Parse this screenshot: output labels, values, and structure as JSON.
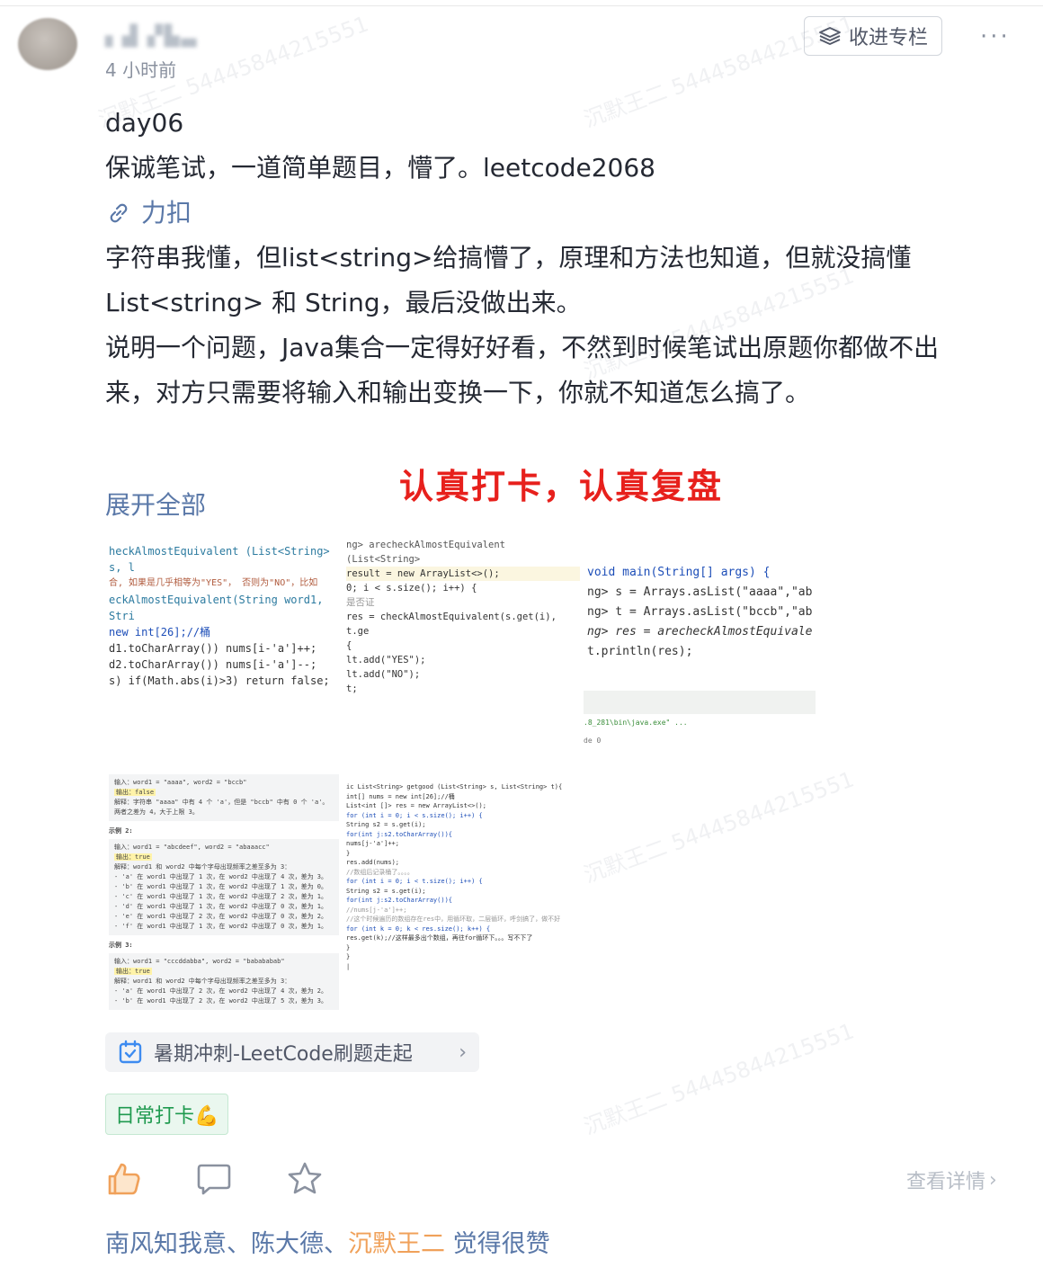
{
  "post": {
    "time": "4 小时前",
    "follow_label": "收进专栏",
    "more_label": "···",
    "lines": [
      "day06",
      "保诚笔试，一道简单题目，懵了。leetcode2068"
    ],
    "link_label": "力扣",
    "body": [
      "字符串我懂，但list<string>给搞懵了，原理和方法也知道，但就没搞懂",
      "List<string> 和 String，最后没做出来。",
      "说明一个问题，Java集合一定得好好看，不然到时候笔试出原题你都做不出",
      "来，对方只需要将输入和输出变换一下，你就不知道怎么搞了。"
    ],
    "red_banner": "认真打卡，认真复盘",
    "expand_label": "展开全部"
  },
  "screenshot": {
    "left_code": [
      "heckAlmostEquivalent (List<String> s, l",
      "合, 如果是几乎相等为\"YES\"， 否则为\"NO\"，比如",
      "",
      "",
      "eckAlmostEquivalent(String word1, Stri",
      "new int[26];//桶",
      "",
      "d1.toCharArray())  nums[i-'a']++;",
      "d2.toCharArray())  nums[i-'a']--;",
      "s) if(Math.abs(i)>3)  return false;"
    ],
    "mid_code": [
      "ng> arecheckAlmostEquivalent (List<String>",
      "",
      " result = new ArrayList<>();",
      "",
      "0; i < s.size(); i++) {",
      "是否证",
      "res = checkAlmostEquivalent(s.get(i), t.ge",
      "{",
      "lt.add(\"YES\");",
      "",
      "lt.add(\"NO\");",
      "",
      "",
      "t;"
    ],
    "right_code": [
      "void main(String[] args) {",
      "ng> s = Arrays.asList(\"aaaa\",\"ab",
      "ng> t = Arrays.asList(\"bccb\",\"ab",
      "ng> res = arecheckAlmostEquivale",
      "t.println(res);"
    ],
    "right_term": ".8_281\\bin\\java.exe\" ...",
    "right_exit": "de 0",
    "examples": [
      {
        "title": "",
        "lines": [
          "输入：word1 = \"aaaa\", word2 = \"bccb\"",
          "输出：false",
          "解释：字符串 \"aaaa\" 中有 4 个 'a'，但是 \"bccb\" 中有 0 个 'a'。",
          "两者之差为 4，大于上限 3。"
        ]
      },
      {
        "title": "示例 2:",
        "lines": [
          "输入：word1 = \"abcdeef\", word2 = \"abaaacc\"",
          "输出：true",
          "解释：word1 和 word2 中每个字母出现频率之差至多为 3：",
          "- 'a' 在 word1 中出现了 1 次，在 word2 中出现了 4 次，差为 3。",
          "- 'b' 在 word1 中出现了 1 次，在 word2 中出现了 1 次，差为 0。",
          "- 'c' 在 word1 中出现了 1 次，在 word2 中出现了 2 次，差为 1。",
          "- 'd' 在 word1 中出现了 1 次，在 word2 中出现了 0 次，差为 1。",
          "- 'e' 在 word1 中出现了 2 次，在 word2 中出现了 0 次，差为 2。",
          "- 'f' 在 word1 中出现了 1 次，在 word2 中出现了 0 次，差为 1。"
        ]
      },
      {
        "title": "示例 3:",
        "lines": [
          "输入：word1 = \"cccddabba\", word2 = \"babababab\"",
          "输出：true",
          "解释：word1 和 word2 中每个字母出现频率之差至多为 3：",
          "- 'a' 在 word1 中出现了 2 次，在 word2 中出现了 4 次，差为 2。",
          "- 'b' 在 word1 中出现了 2 次，在 word2 中出现了 5 次，差为 3。"
        ]
      }
    ],
    "bottom_code": [
      "ic List<String> getgood (List<String> s, List<String> t){",
      "int[] nums = new int[26];//桶",
      "List<int []> res = new ArrayList<>();",
      "for (int i = 0; i < s.size(); i++) {",
      "    String s2 = s.get(i);",
      "    for(int j:s2.toCharArray()){",
      "        nums[j-'a']++;",
      "    }",
      "    res.add(nums);",
      "    //数组后记录桶了。。。。",
      "",
      "for (int i = 0; i < t.size(); i++) {",
      "    String s2 = s.get(i);",
      "    for(int j:s2.toCharArray()){",
      "        //nums[j-'a']++;",
      "        //这个时候遍历的数组存在res中，用循环取，二层循环，呼剑搞了，做不好",
      "        for (int k = 0; k < res.size(); k++) {",
      "            res.get(k);//这样最多出个数组，再往for循环下。。。写不下了",
      "        }",
      "    }",
      "|"
    ]
  },
  "topic": {
    "label": "暑期冲刺-LeetCode刷题走起"
  },
  "tag": {
    "label": "日常打卡💪"
  },
  "actions": {
    "details_label": "查看详情"
  },
  "likers": {
    "names": "南风知我意、陈大德、",
    "me": "沉默王二",
    "suffix": " 觉得很赞"
  },
  "watermark": "沉默王二 54445844215551",
  "colors": {
    "link": "#5a78a8",
    "red": "#e7201c",
    "tag_green": "#1f9a4f",
    "like_orange": "#f0a15a"
  }
}
